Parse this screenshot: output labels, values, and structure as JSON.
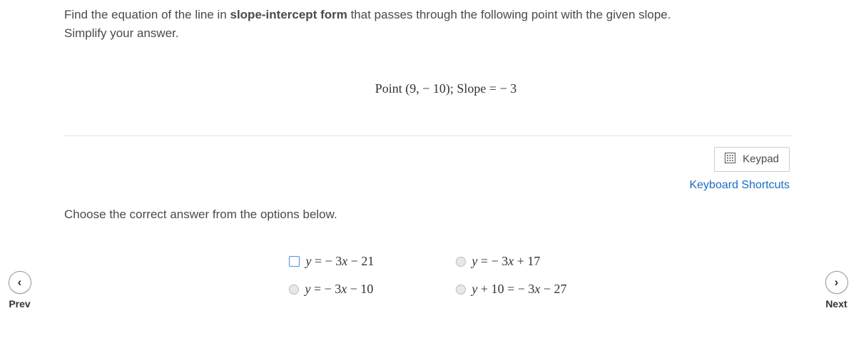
{
  "question": {
    "line1_before": "Find the equation of the line in ",
    "line1_bold": "slope-intercept form",
    "line1_after": " that passes through the following point with the given slope.",
    "line2": "Simplify your answer."
  },
  "point_slope": "Point (9, − 10); Slope = − 3",
  "toolbar": {
    "keypad_label": "Keypad",
    "shortcuts_label": "Keyboard Shortcuts"
  },
  "instruction": "Choose the correct answer from the options below.",
  "options": {
    "a": "y = − 3x − 21",
    "b": "y = − 3x + 17",
    "c": "y = − 3x − 10",
    "d": "y + 10 = − 3x − 27"
  },
  "nav": {
    "prev_label": "Prev",
    "next_label": "Next"
  }
}
